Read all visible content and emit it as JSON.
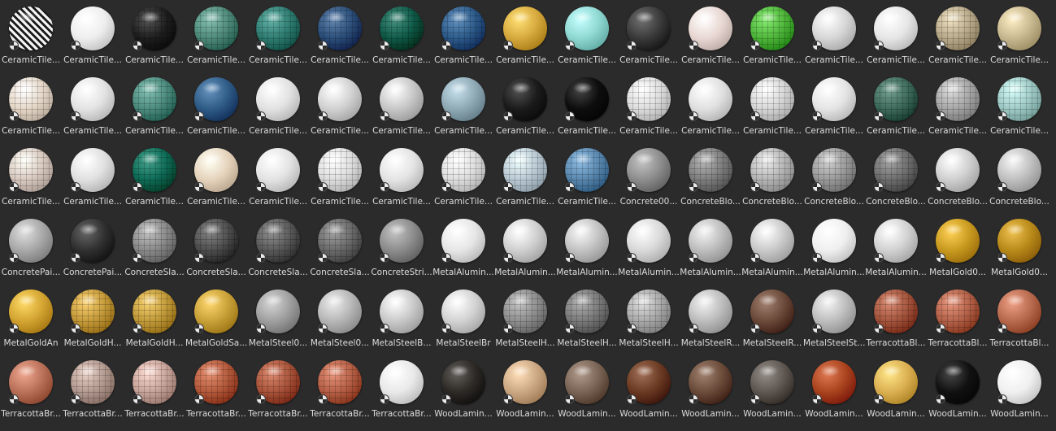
{
  "items": [
    {
      "name": "CeramicTile...",
      "color": "#e8e8e8",
      "style": "pattern-bw"
    },
    {
      "name": "CeramicTile...",
      "color": "#eeeeee",
      "style": "plain"
    },
    {
      "name": "CeramicTile...",
      "color": "#1e1e1e",
      "style": "tiled"
    },
    {
      "name": "CeramicTile...",
      "color": "#4f8a7a",
      "style": "tiled"
    },
    {
      "name": "CeramicTile...",
      "color": "#2f7d72",
      "style": "tiled"
    },
    {
      "name": "CeramicTile...",
      "color": "#2c4f7a",
      "style": "tiled"
    },
    {
      "name": "CeramicTile...",
      "color": "#0f5a48",
      "style": "tiled"
    },
    {
      "name": "CeramicTile...",
      "color": "#2d5b8a",
      "style": "tiled"
    },
    {
      "name": "CeramicTile...",
      "color": "#d6a93e",
      "style": "plain"
    },
    {
      "name": "CeramicTile...",
      "color": "#8fd8d2",
      "style": "plain"
    },
    {
      "name": "CeramicTile...",
      "color": "#3a3a3a",
      "style": "plain"
    },
    {
      "name": "CeramicTile...",
      "color": "#e8d7d2",
      "style": "plain"
    },
    {
      "name": "CeramicTile...",
      "color": "#4fb53b",
      "style": "tiled"
    },
    {
      "name": "CeramicTile...",
      "color": "#d6d6d6",
      "style": "plain"
    },
    {
      "name": "CeramicTile...",
      "color": "#e6e6e6",
      "style": "plain"
    },
    {
      "name": "CeramicTile...",
      "color": "#b8aa8a",
      "style": "tiled"
    },
    {
      "name": "CeramicTile...",
      "color": "#c8b890",
      "style": "plain"
    },
    {
      "name": "CeramicTile...",
      "color": "#e5d7c8",
      "style": "tiled"
    },
    {
      "name": "CeramicTile...",
      "color": "#e3e3e3",
      "style": "plain"
    },
    {
      "name": "CeramicTile...",
      "color": "#4d8b7e",
      "style": "tiled"
    },
    {
      "name": "CeramicTile...",
      "color": "#2f5c87",
      "style": "plain"
    },
    {
      "name": "CeramicTile...",
      "color": "#e2e2e2",
      "style": "plain"
    },
    {
      "name": "CeramicTile...",
      "color": "#d1d1d1",
      "style": "plain"
    },
    {
      "name": "CeramicTile...",
      "color": "#c7c7c7",
      "style": "plain"
    },
    {
      "name": "CeramicTile...",
      "color": "#8fa9b5",
      "style": "plain"
    },
    {
      "name": "CeramicTile...",
      "color": "#1b1b1b",
      "style": "plain"
    },
    {
      "name": "CeramicTile...",
      "color": "#0d0d0d",
      "style": "plain"
    },
    {
      "name": "CeramicTile...",
      "color": "#dcdcdc",
      "style": "tiled"
    },
    {
      "name": "CeramicTile...",
      "color": "#e0e0e0",
      "style": "plain"
    },
    {
      "name": "CeramicTile...",
      "color": "#d6d6d6",
      "style": "tiled"
    },
    {
      "name": "CeramicTile...",
      "color": "#e4e4e4",
      "style": "plain"
    },
    {
      "name": "CeramicTile...",
      "color": "#3f6b5d",
      "style": "tiled"
    },
    {
      "name": "CeramicTile...",
      "color": "#a6a6a6",
      "style": "tiled"
    },
    {
      "name": "CeramicTile...",
      "color": "#9fc9c4",
      "style": "tiled"
    },
    {
      "name": "CeramicTile...",
      "color": "#d8c9c0",
      "style": "tiled"
    },
    {
      "name": "CeramicTile...",
      "color": "#e0e0e0",
      "style": "plain"
    },
    {
      "name": "CeramicTile...",
      "color": "#0e6b56",
      "style": "tiled"
    },
    {
      "name": "CeramicTile...",
      "color": "#e5d3bc",
      "style": "plain"
    },
    {
      "name": "CeramicTile...",
      "color": "#e3e3e3",
      "style": "plain"
    },
    {
      "name": "CeramicTile...",
      "color": "#dddddd",
      "style": "tiled"
    },
    {
      "name": "CeramicTile...",
      "color": "#e4e4e4",
      "style": "plain"
    },
    {
      "name": "CeramicTile...",
      "color": "#dedede",
      "style": "tiled"
    },
    {
      "name": "CeramicTile...",
      "color": "#b9c9d3",
      "style": "tiled"
    },
    {
      "name": "CeramicTile...",
      "color": "#5a87ad",
      "style": "tiled"
    },
    {
      "name": "Concrete00...",
      "color": "#8d8d8d",
      "style": "plain"
    },
    {
      "name": "ConcreteBlo...",
      "color": "#7e7e7e",
      "style": "tiled"
    },
    {
      "name": "ConcreteBlo...",
      "color": "#b5b5b5",
      "style": "tiled"
    },
    {
      "name": "ConcreteBlo...",
      "color": "#9a9a9a",
      "style": "tiled"
    },
    {
      "name": "ConcreteBlo...",
      "color": "#6e6e6e",
      "style": "tiled"
    },
    {
      "name": "ConcreteBlo...",
      "color": "#cfcfcf",
      "style": "plain"
    },
    {
      "name": "ConcreteBlo...",
      "color": "#bfbfbf",
      "style": "plain"
    },
    {
      "name": "ConcretePai...",
      "color": "#a8a8a8",
      "style": "plain"
    },
    {
      "name": "ConcretePai...",
      "color": "#303030",
      "style": "plain"
    },
    {
      "name": "ConcreteSla...",
      "color": "#8a8a8a",
      "style": "tiled"
    },
    {
      "name": "ConcreteSla...",
      "color": "#4e4e4e",
      "style": "tiled"
    },
    {
      "name": "ConcreteSla...",
      "color": "#5a5a5a",
      "style": "tiled"
    },
    {
      "name": "ConcreteSla...",
      "color": "#6a6a6a",
      "style": "tiled"
    },
    {
      "name": "ConcreteStri...",
      "color": "#8c8c8c",
      "style": "plain"
    },
    {
      "name": "MetalAlumin...",
      "color": "#e6e6e6",
      "style": "plain"
    },
    {
      "name": "MetalAlumin...",
      "color": "#cfcfcf",
      "style": "plain"
    },
    {
      "name": "MetalAlumin...",
      "color": "#c2c2c2",
      "style": "plain"
    },
    {
      "name": "MetalAlumin...",
      "color": "#d9d9d9",
      "style": "plain"
    },
    {
      "name": "MetalAlumin...",
      "color": "#bdbdbd",
      "style": "plain"
    },
    {
      "name": "MetalAlumin...",
      "color": "#c9c9c9",
      "style": "plain"
    },
    {
      "name": "MetalAlumin...",
      "color": "#efefef",
      "style": "plain"
    },
    {
      "name": "MetalAlumin...",
      "color": "#d1d1d1",
      "style": "plain"
    },
    {
      "name": "MetalGold0...",
      "color": "#c89a1f",
      "style": "plain"
    },
    {
      "name": "MetalGold0...",
      "color": "#b88a1a",
      "style": "plain"
    },
    {
      "name": "MetalGoldAn",
      "color": "#d3a431",
      "style": "plain"
    },
    {
      "name": "MetalGoldH...",
      "color": "#c49a3a",
      "style": "tiled"
    },
    {
      "name": "MetalGoldH...",
      "color": "#c19a3a",
      "style": "tiled"
    },
    {
      "name": "MetalGoldSa...",
      "color": "#c9a139",
      "style": "plain"
    },
    {
      "name": "MetalSteel0...",
      "color": "#9f9f9f",
      "style": "plain"
    },
    {
      "name": "MetalSteel0...",
      "color": "#b6b6b6",
      "style": "plain"
    },
    {
      "name": "MetalSteelB...",
      "color": "#c9c9c9",
      "style": "plain"
    },
    {
      "name": "MetalSteelBr",
      "color": "#d2d2d2",
      "style": "plain"
    },
    {
      "name": "MetalSteelH...",
      "color": "#8e8e8e",
      "style": "tiled"
    },
    {
      "name": "MetalSteelH...",
      "color": "#7a7a7a",
      "style": "tiled"
    },
    {
      "name": "MetalSteelH...",
      "color": "#a9a9a9",
      "style": "tiled"
    },
    {
      "name": "MetalSteelR...",
      "color": "#bcbcbc",
      "style": "plain"
    },
    {
      "name": "MetalSteelR...",
      "color": "#6b4a3a",
      "style": "plain"
    },
    {
      "name": "MetalSteelSt...",
      "color": "#bdbdbd",
      "style": "plain"
    },
    {
      "name": "TerracottaBl...",
      "color": "#a4553d",
      "style": "tiled"
    },
    {
      "name": "TerracottaBl...",
      "color": "#b36249",
      "style": "tiled"
    },
    {
      "name": "TerracottaBl...",
      "color": "#b86a4f",
      "style": "plain"
    },
    {
      "name": "TerracottaBr...",
      "color": "#b9715a",
      "style": "plain"
    },
    {
      "name": "TerracottaBr...",
      "color": "#b39a90",
      "style": "tiled"
    },
    {
      "name": "TerracottaBr...",
      "color": "#c7a49a",
      "style": "tiled"
    },
    {
      "name": "TerracottaBr...",
      "color": "#b35a3c",
      "style": "tiled"
    },
    {
      "name": "TerracottaBr...",
      "color": "#a8543a",
      "style": "tiled"
    },
    {
      "name": "TerracottaBr...",
      "color": "#b56046",
      "style": "tiled"
    },
    {
      "name": "TerracottaBr...",
      "color": "#e9e9e9",
      "style": "plain"
    },
    {
      "name": "WoodLamin...",
      "color": "#2d2a26",
      "style": "plain"
    },
    {
      "name": "WoodLamin...",
      "color": "#cba883",
      "style": "plain"
    },
    {
      "name": "WoodLamin...",
      "color": "#7a6455",
      "style": "plain"
    },
    {
      "name": "WoodLamin...",
      "color": "#6b3a22",
      "style": "plain"
    },
    {
      "name": "WoodLamin...",
      "color": "#6b4c3a",
      "style": "plain"
    },
    {
      "name": "WoodLamin...",
      "color": "#5e5752",
      "style": "plain"
    },
    {
      "name": "WoodLamin...",
      "color": "#a9441e",
      "style": "plain"
    },
    {
      "name": "WoodLamin...",
      "color": "#dbb052",
      "style": "plain"
    },
    {
      "name": "WoodLamin...",
      "color": "#111111",
      "style": "plain"
    },
    {
      "name": "WoodLamin...",
      "color": "#f0f0f0",
      "style": "plain"
    }
  ]
}
